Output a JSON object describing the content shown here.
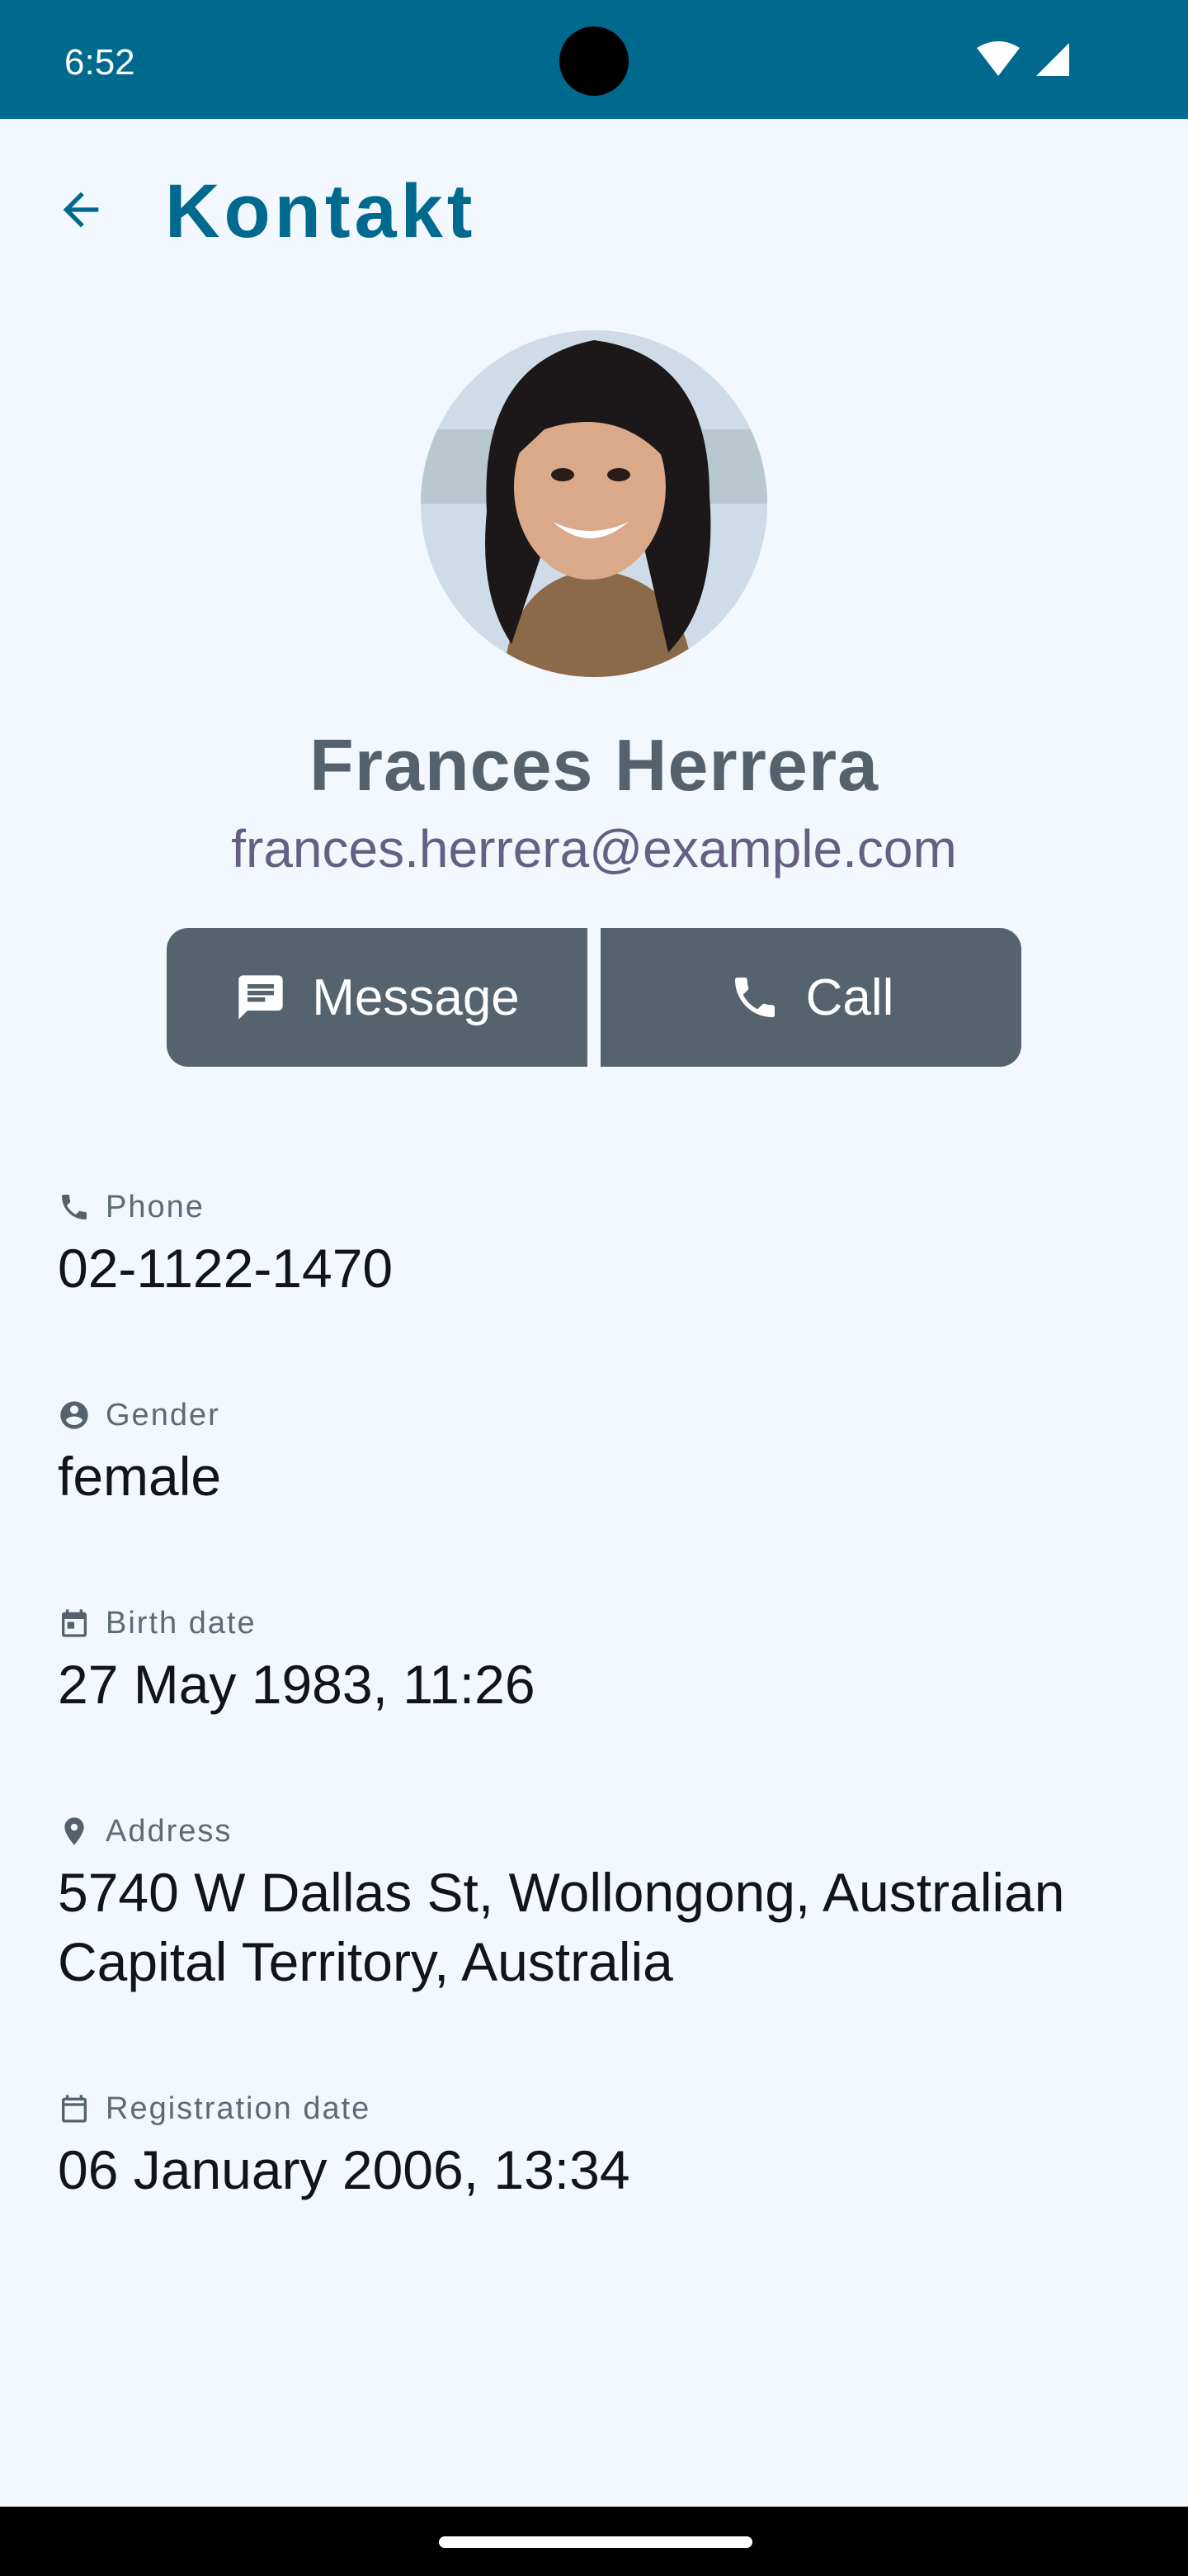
{
  "status_bar": {
    "time": "6:52"
  },
  "app_bar": {
    "title": "Kontakt"
  },
  "contact": {
    "name": "Frances Herrera",
    "email": "frances.herrera@example.com"
  },
  "actions": {
    "message_label": "Message",
    "call_label": "Call"
  },
  "fields": [
    {
      "label": "Phone",
      "value": "02-1122-1470",
      "icon": "phone-icon"
    },
    {
      "label": "Gender",
      "value": "female",
      "icon": "account-circle-icon"
    },
    {
      "label": "Birth date",
      "value": "27 May 1983, 11:26",
      "icon": "calendar-icon"
    },
    {
      "label": "Address",
      "value": "5740 W Dallas St, Wollongong, Australian Capital Territory, Australia",
      "icon": "location-pin-icon"
    },
    {
      "label": "Registration date",
      "value": "06 January 2006, 13:34",
      "icon": "calendar-icon"
    }
  ],
  "colors": {
    "status_bar": "#006a8e",
    "accent": "#006a8e",
    "background": "#f2f8fd",
    "button": "#54636e"
  }
}
